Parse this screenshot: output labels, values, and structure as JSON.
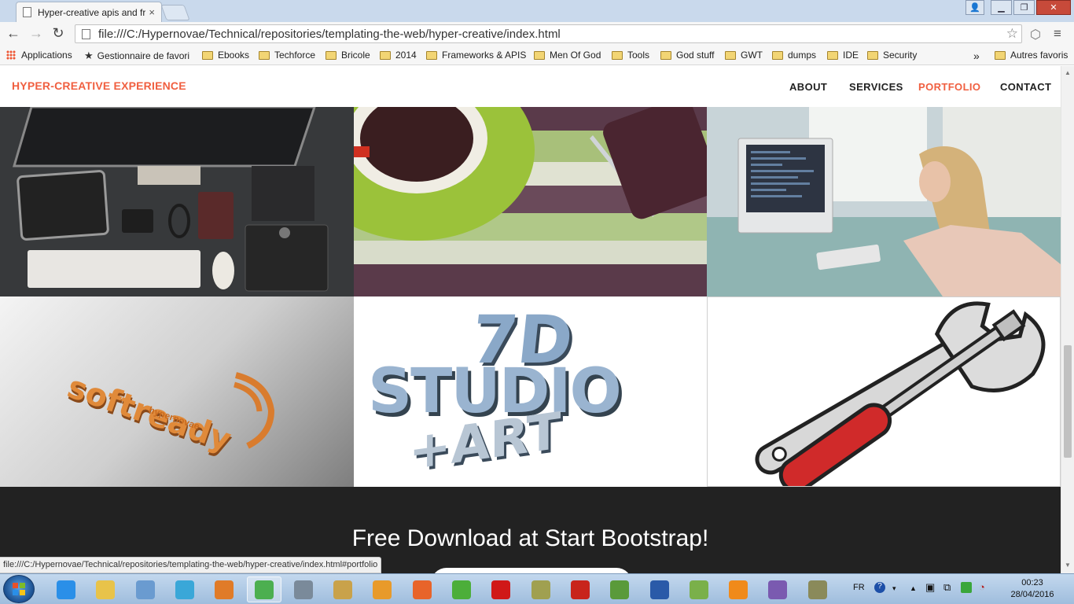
{
  "browser": {
    "tab_title": "Hyper-creative apis and fr",
    "tab_close": "×",
    "url": "file:///C:/Hypernovae/Technical/repositories/templating-the-web/hyper-creative/index.html",
    "status_url": "file:///C:/Hypernovae/Technical/repositories/templating-the-web/hyper-creative/index.html#portfolio",
    "window_controls": {
      "minimize": "▁",
      "maximize": "❐",
      "close": "✕",
      "user": "👤"
    },
    "nav": {
      "back": "←",
      "forward": "→",
      "reload": "↻",
      "star": "☆",
      "menu": "≡",
      "ext": "⬡"
    }
  },
  "bookmarks": {
    "items": [
      {
        "label": "Applications",
        "icon": "apps-grid-icon"
      },
      {
        "label": "Gestionnaire de favori",
        "icon": "star-icon"
      },
      {
        "label": "Ebooks",
        "icon": "folder-icon"
      },
      {
        "label": "Techforce",
        "icon": "folder-icon"
      },
      {
        "label": "Bricole",
        "icon": "folder-icon"
      },
      {
        "label": "2014",
        "icon": "folder-icon"
      },
      {
        "label": "Frameworks & APIS",
        "icon": "folder-icon"
      },
      {
        "label": "Men Of God",
        "icon": "folder-icon"
      },
      {
        "label": "Tools",
        "icon": "folder-icon"
      },
      {
        "label": "God stuff",
        "icon": "folder-icon"
      },
      {
        "label": "GWT",
        "icon": "folder-icon"
      },
      {
        "label": "dumps",
        "icon": "folder-icon"
      },
      {
        "label": "IDE",
        "icon": "folder-icon"
      },
      {
        "label": "Security",
        "icon": "folder-icon"
      }
    ],
    "overflow": "»",
    "other": "Autres favoris"
  },
  "site": {
    "brand": "HYPER-CREATIVE EXPERIENCE",
    "nav": [
      "ABOUT",
      "SERVICES",
      "PORTFOLIO",
      "CONTACT"
    ],
    "active_nav": "PORTFOLIO",
    "accent": "#f05f40",
    "portfolio_tiles": [
      {
        "name": "desk-devices",
        "logo_text": ""
      },
      {
        "name": "coffee-cup-stripes",
        "logo_text": ""
      },
      {
        "name": "woman-at-computer",
        "logo_text": ""
      },
      {
        "name": "softready-logo",
        "logo_text": "softready",
        "logo_sub": "hypernovae"
      },
      {
        "name": "7d-studio-art",
        "logo_text": "7D",
        "logo_sub": "STUDIO",
        "logo_sub2": "+ART"
      },
      {
        "name": "wrench-screwdriver",
        "logo_text": ""
      }
    ],
    "cta_title": "Free Download at Start Bootstrap!",
    "cta_bg": "#222222"
  },
  "taskbar": {
    "language": "FR",
    "time": "00:23",
    "date": "28/04/2016",
    "apps": [
      {
        "name": "internet-explorer",
        "color": "#2a8fe8"
      },
      {
        "name": "file-explorer",
        "color": "#e8c34a"
      },
      {
        "name": "monitor-app",
        "color": "#6a9bd0"
      },
      {
        "name": "circle-app",
        "color": "#3aa7d8"
      },
      {
        "name": "java-app",
        "color": "#e07b28"
      },
      {
        "name": "chrome",
        "color": "#4caf50"
      },
      {
        "name": "network-tool",
        "color": "#7a8a9a"
      },
      {
        "name": "paint",
        "color": "#c9a24a"
      },
      {
        "name": "media-player",
        "color": "#e89a2a"
      },
      {
        "name": "firefox",
        "color": "#e8642a"
      },
      {
        "name": "green-app",
        "color": "#4cae3a"
      },
      {
        "name": "opera",
        "color": "#d01818"
      },
      {
        "name": "w-app",
        "color": "#a0a050"
      },
      {
        "name": "acrobat",
        "color": "#c8241c"
      },
      {
        "name": "notepad-app",
        "color": "#5a9a3a"
      },
      {
        "name": "play-app",
        "color": "#2a5aa8"
      },
      {
        "name": "paper-plane-app",
        "color": "#7ab04a"
      },
      {
        "name": "vlc",
        "color": "#f08a1a"
      },
      {
        "name": "cat-app",
        "color": "#7a5ab0"
      },
      {
        "name": "game-app",
        "color": "#8a8a5a"
      }
    ]
  }
}
